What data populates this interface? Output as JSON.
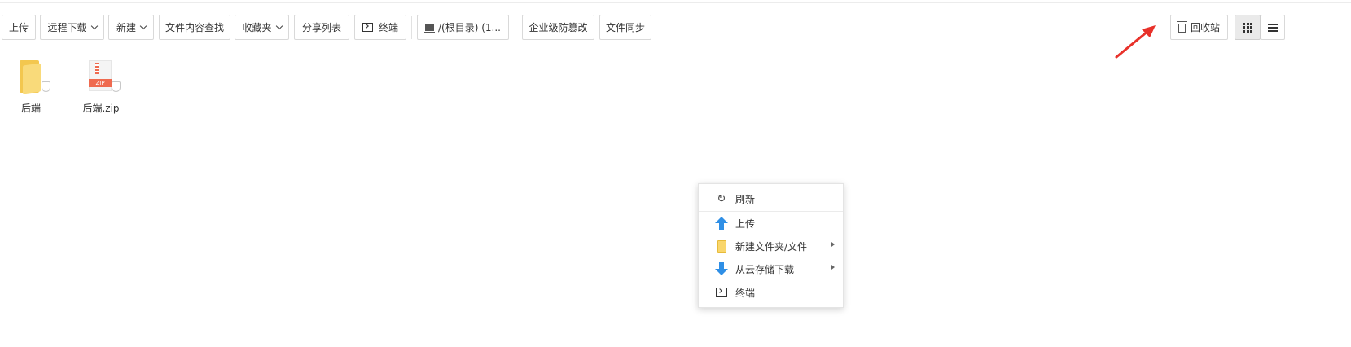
{
  "toolbar": {
    "upload": "上传",
    "remote_download": "远程下载",
    "new": "新建",
    "content_search": "文件内容查找",
    "favorites": "收藏夹",
    "share_list": "分享列表",
    "terminal": "终端",
    "path": "/(根目录) (1...",
    "tamper_proof": "企业级防篡改",
    "file_sync": "文件同步",
    "recycle_bin": "回收站"
  },
  "files": [
    {
      "name": "后端",
      "type": "folder",
      "icon": "folder-icon"
    },
    {
      "name": "后端.zip",
      "type": "zip",
      "icon": "zip-file-icon",
      "badge": "ZIP"
    }
  ],
  "context_menu": {
    "items": [
      {
        "label": "刷新",
        "icon": "refresh-icon"
      },
      {
        "label": "上传",
        "icon": "upload-arrow-icon"
      },
      {
        "label": "新建文件夹/文件",
        "icon": "folder-icon",
        "submenu": true
      },
      {
        "label": "从云存储下载",
        "icon": "download-arrow-icon",
        "submenu": true
      },
      {
        "label": "终端",
        "icon": "terminal-icon"
      }
    ]
  },
  "view_mode": "grid",
  "colors": {
    "accent_arrow": "#e8312a",
    "folder": "#f9da7a",
    "zip": "#ef6a4f",
    "menu_icon_blue": "#2f8fe6"
  }
}
